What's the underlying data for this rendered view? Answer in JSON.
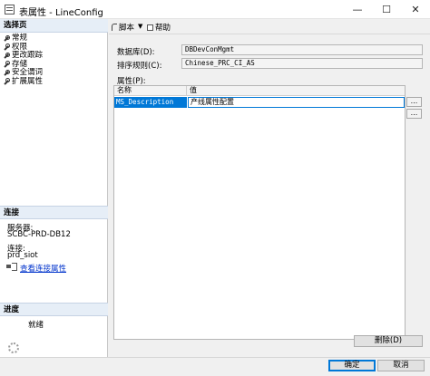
{
  "window": {
    "title": "表属性 - LineConfig",
    "minimize_glyph": "—",
    "maximize_glyph": "☐",
    "close_glyph": "✕"
  },
  "left": {
    "pages_header": "选择页",
    "pages": [
      {
        "label": "常规",
        "icon": "wrench-icon"
      },
      {
        "label": "权限",
        "icon": "wrench-icon"
      },
      {
        "label": "更改跟踪",
        "icon": "wrench-icon"
      },
      {
        "label": "存储",
        "icon": "wrench-icon"
      },
      {
        "label": "安全谓词",
        "icon": "wrench-icon"
      },
      {
        "label": "扩展属性",
        "icon": "wrench-icon"
      }
    ],
    "connection_header": "连接",
    "server_label": "服务器:",
    "server_value": "SCBC-PRD-DB12",
    "connection_label": "连接:",
    "connection_value": "prd_siot",
    "view_connection_link": "查看连接属性",
    "progress_header": "进度",
    "progress_status": "就绪"
  },
  "toolbar": {
    "script_label": "脚本",
    "script_dropdown": "▼",
    "help_label": "帮助"
  },
  "form": {
    "database_label": "数据库(D):",
    "database_value": "DBDevConMgmt",
    "collation_label": "排序规则(C):",
    "collation_value": "Chinese_PRC_CI_AS",
    "properties_label": "属性(P):"
  },
  "grid": {
    "columns": [
      "名称",
      "值"
    ],
    "rows": [
      {
        "name": "MS_Description",
        "value": "产线属性配置"
      }
    ],
    "ellipsis_label": "..."
  },
  "buttons": {
    "delete": "删除(D)",
    "ok": "确定",
    "cancel": "取消"
  },
  "colors": {
    "selection": "#0078d7",
    "link": "#0033cc",
    "header_bg": "#e6eef7"
  }
}
